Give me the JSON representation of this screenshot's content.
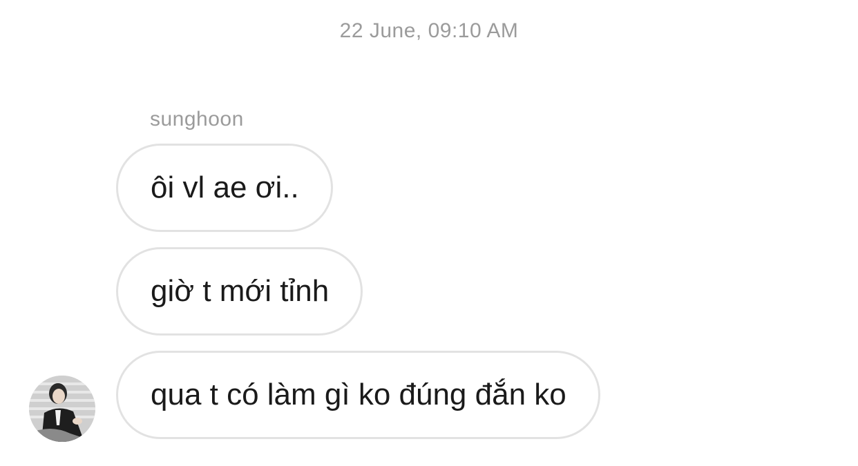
{
  "chat": {
    "timestamp": "22 June, 09:10 AM",
    "sender": "sunghoon",
    "messages": [
      {
        "text": "ôi vl ae ơi.."
      },
      {
        "text": "giờ t mới tỉnh"
      },
      {
        "text": "qua t có làm gì ko đúng đắn ko"
      }
    ],
    "avatar_icon": "profile-photo",
    "colors": {
      "background": "#ffffff",
      "bubble_border": "#e2e2e2",
      "meta_text": "#9b9b9b",
      "message_text": "#1a1a1a"
    }
  }
}
